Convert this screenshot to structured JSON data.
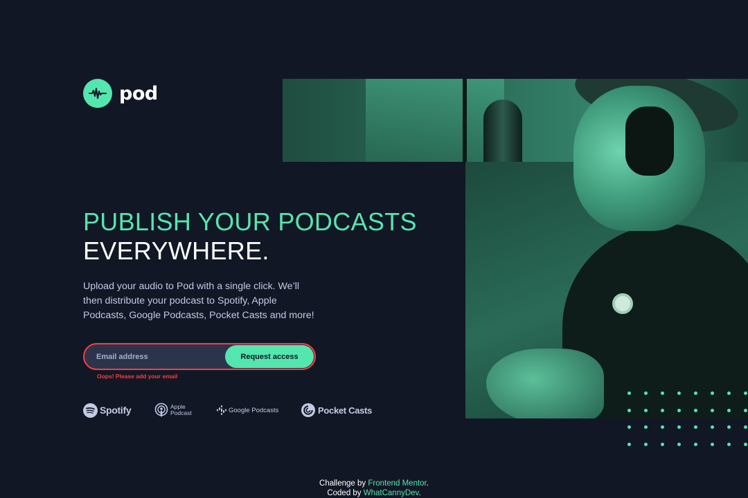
{
  "brand": {
    "name": "pod",
    "accent_color": "#54e6af",
    "background_color": "#121725",
    "error_color": "#fb3e3e"
  },
  "hero": {
    "headline_accent": "PUBLISH YOUR PODCASTS",
    "headline_main": "EVERYWHERE.",
    "description": "Upload your audio to Pod with a single click. We’ll then distribute your podcast to Spotify, Apple Podcasts, Google Podcasts, Pocket Casts and more!",
    "image_icon": "podcaster-photo"
  },
  "form": {
    "email_placeholder": "Email address",
    "email_value": "",
    "submit_label": "Request access",
    "error_message": "Oops! Please add your email"
  },
  "platforms": [
    {
      "name": "Spotify",
      "icon": "spotify-icon"
    },
    {
      "name": "Apple\nPodcast",
      "icon": "apple-podcast-icon"
    },
    {
      "name": "Google Podcasts",
      "icon": "google-podcasts-icon"
    },
    {
      "name": "Pocket Casts",
      "icon": "pocket-casts-icon"
    }
  ],
  "footer": {
    "challenge_prefix": "Challenge by",
    "challenge_link": "Frontend Mentor",
    "coded_prefix": "Coded by",
    "coded_link": "WhatCannyDev",
    "period": "."
  }
}
